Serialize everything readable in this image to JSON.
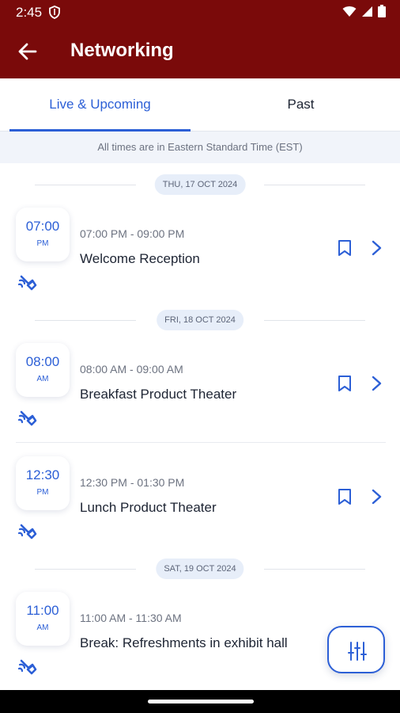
{
  "status_bar": {
    "time": "2:45"
  },
  "app_bar": {
    "title": "Networking"
  },
  "tabs": [
    {
      "label": "Live & Upcoming",
      "active": true
    },
    {
      "label": "Past",
      "active": false
    }
  ],
  "timezone_note": "All times are in Eastern Standard Time (EST)",
  "days": [
    {
      "date": "THU, 17 OCT 2024",
      "sessions": [
        {
          "time": "07:00",
          "ampm": "PM",
          "range": "07:00 PM - 09:00 PM",
          "name": "Welcome Reception"
        }
      ]
    },
    {
      "date": "FRI, 18 OCT 2024",
      "sessions": [
        {
          "time": "08:00",
          "ampm": "AM",
          "range": "08:00 AM - 09:00 AM",
          "name": "Breakfast Product Theater"
        },
        {
          "time": "12:30",
          "ampm": "PM",
          "range": "12:30 PM - 01:30 PM",
          "name": "Lunch Product Theater"
        }
      ]
    },
    {
      "date": "SAT, 19 OCT 2024",
      "sessions": [
        {
          "time": "11:00",
          "ampm": "AM",
          "range": "11:00 AM - 11:30 AM",
          "name": "Break: Refreshments in exhibit hall"
        }
      ]
    }
  ],
  "icons": {
    "back": "arrow-left-icon",
    "bookmark": "bookmark-icon",
    "chevron": "chevron-right-icon",
    "networking": "networking-icon",
    "filter": "filter-sliders-icon"
  },
  "colors": {
    "app_bar": "#7a0a0a",
    "accent": "#2c5fd6"
  }
}
